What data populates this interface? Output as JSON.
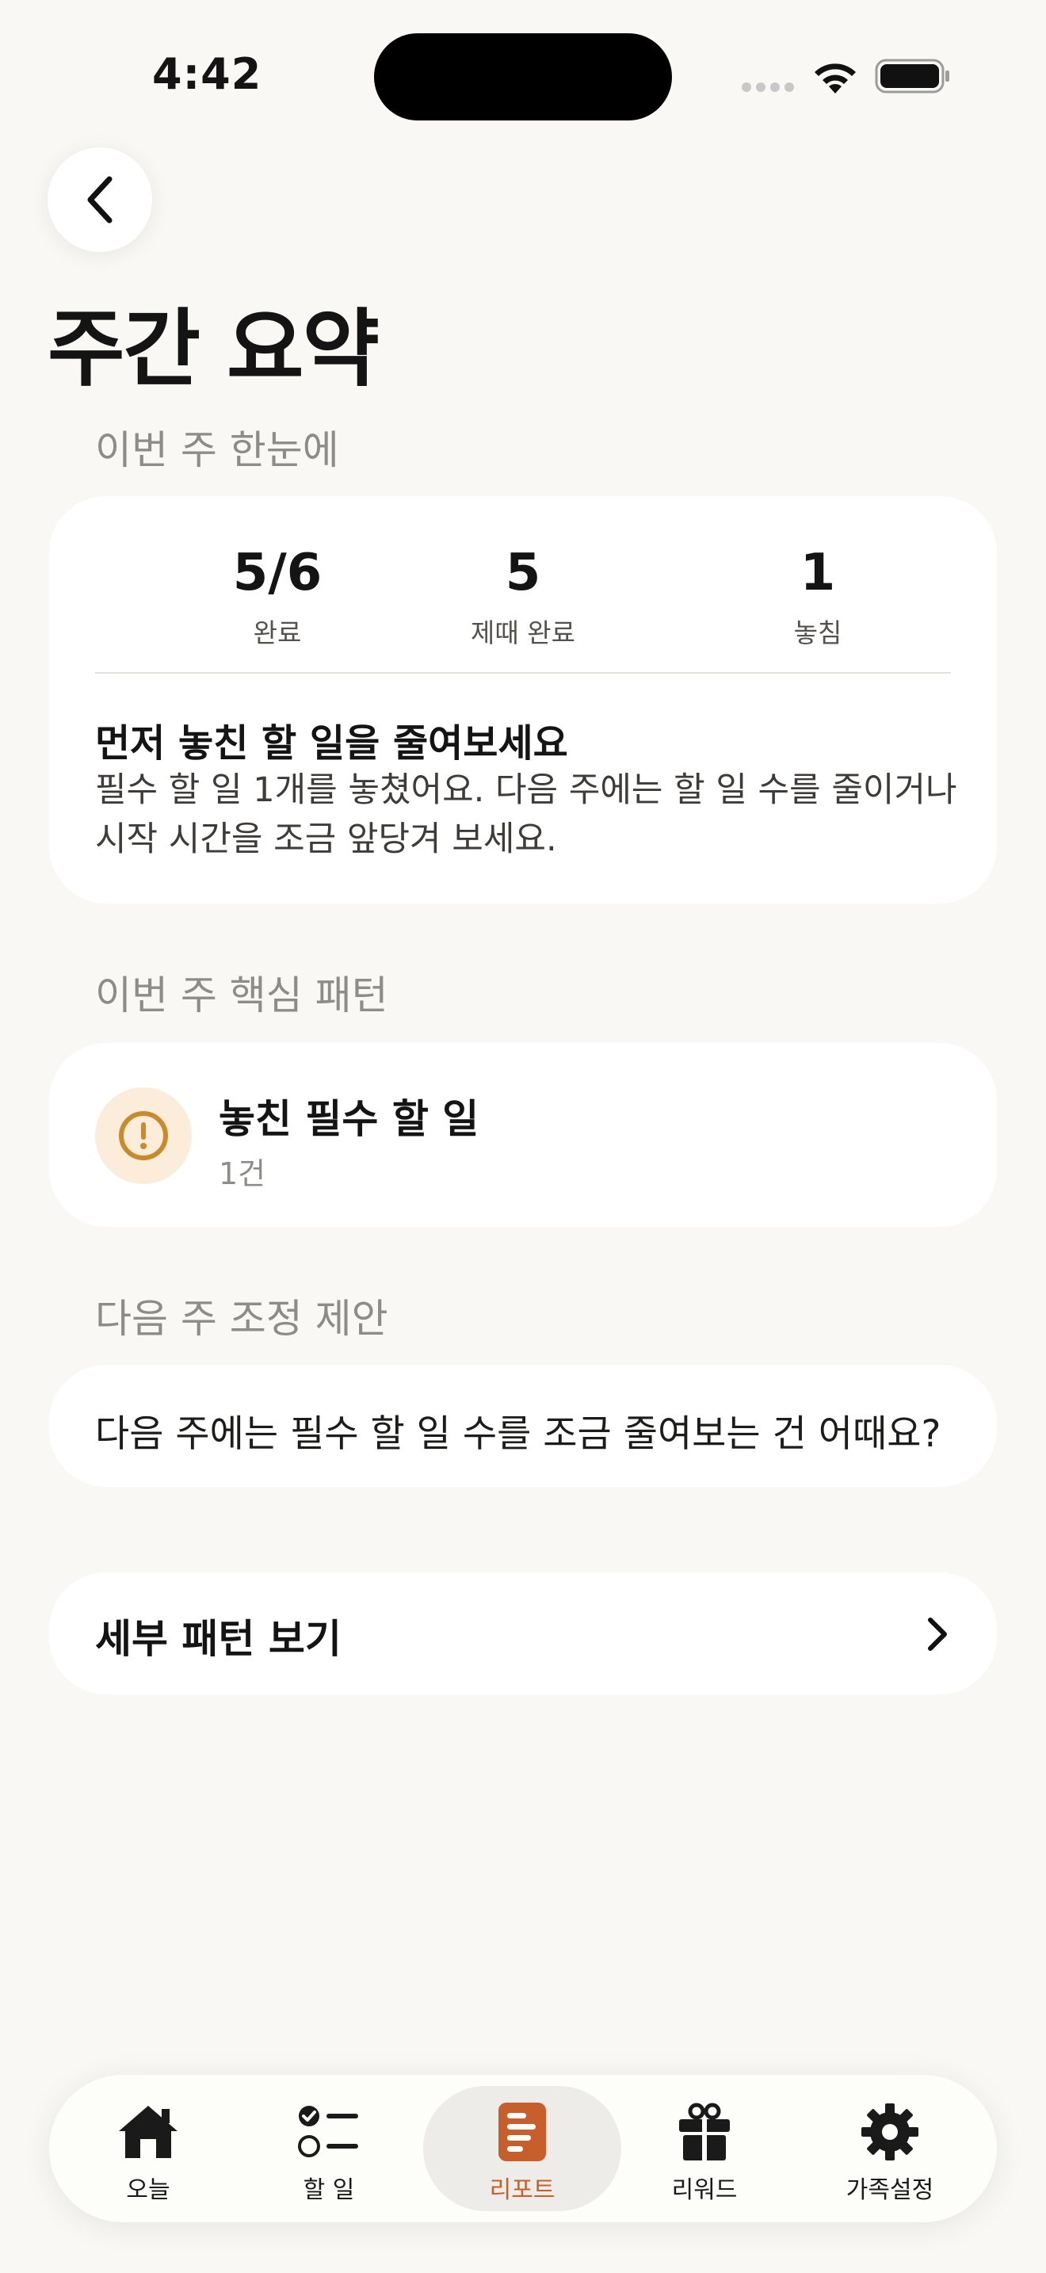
{
  "status_bar": {
    "time": "4:42"
  },
  "page": {
    "title": "주간 요약"
  },
  "summary": {
    "section_label": "이번 주 한눈에",
    "stats": [
      {
        "value": "5/6",
        "label": "완료"
      },
      {
        "value": "5",
        "label": "제때 완료"
      },
      {
        "value": "1",
        "label": "놓침"
      }
    ],
    "insight_title": "먼저 놓친 할 일을 줄여보세요",
    "insight_line1": "필수 할 일 1개를 놓쳤어요. 다음 주에는 할 일 수를 줄이거나",
    "insight_line2": "시작 시간을 조금 앞당겨 보세요."
  },
  "pattern": {
    "section_label": "이번 주 핵심 패턴",
    "title": "놓친 필수 할 일",
    "count": "1건",
    "accent_color": "#C98A2C"
  },
  "suggestion": {
    "section_label": "다음 주 조정 제안",
    "text": "다음 주에는 필수 할 일 수를 조금 줄여보는 건 어때요?"
  },
  "detail": {
    "label": "세부 패턴 보기"
  },
  "tabbar": {
    "active_color": "#C65F2C",
    "tabs": [
      {
        "label": "오늘",
        "icon": "home-icon"
      },
      {
        "label": "할 일",
        "icon": "checklist-icon"
      },
      {
        "label": "리포트",
        "icon": "report-icon",
        "active": true
      },
      {
        "label": "리워드",
        "icon": "gift-icon"
      },
      {
        "label": "가족설정",
        "icon": "gear-icon"
      }
    ]
  }
}
